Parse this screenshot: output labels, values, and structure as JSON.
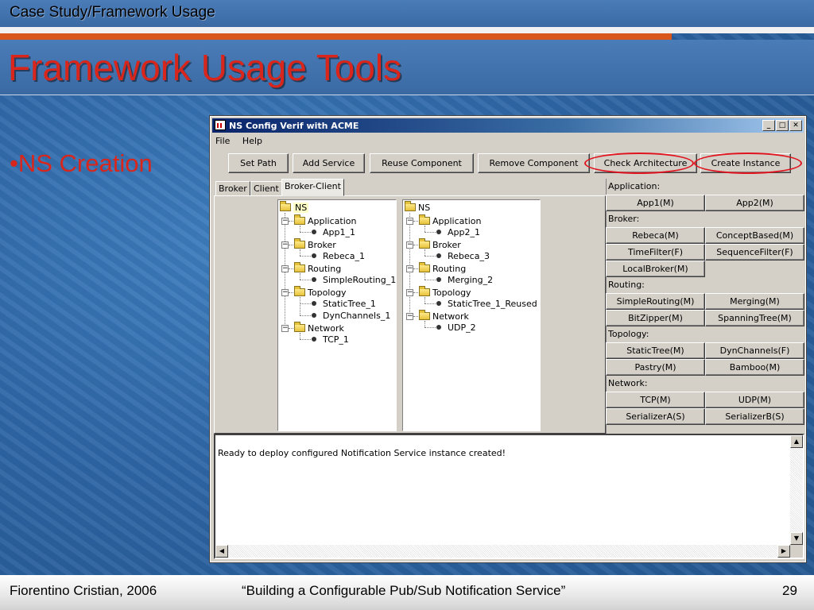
{
  "slide": {
    "section_label": "Case Study/Framework Usage",
    "title": "Framework Usage Tools",
    "bullet": "•NS Creation",
    "footer_author": "Fiorentino Cristian, 2006",
    "footer_title": "“Building a Configurable Pub/Sub Notification Service”",
    "page_number": "29"
  },
  "window": {
    "title": "NS Config Verif with ACME",
    "controls": [
      "minimize-icon",
      "maximize-icon",
      "close-icon"
    ],
    "menu": [
      "File",
      "Help"
    ],
    "buttons": [
      "Set Path",
      "Add Service",
      "Reuse Component",
      "Remove Component",
      "Check Architecture",
      "Create Instance"
    ],
    "highlighted_buttons": [
      "Check Architecture",
      "Create Instance"
    ],
    "highlight_color": "#e0141e",
    "tabs": [
      "Broker",
      "Client",
      "Broker-Client"
    ],
    "active_tab": "Broker-Client",
    "tree_left": {
      "root": "NS",
      "groups": [
        {
          "name": "Application",
          "items": [
            "App1_1"
          ]
        },
        {
          "name": "Broker",
          "items": [
            "Rebeca_1"
          ]
        },
        {
          "name": "Routing",
          "items": [
            "SimpleRouting_1"
          ]
        },
        {
          "name": "Topology",
          "items": [
            "StaticTree_1",
            "DynChannels_1"
          ]
        },
        {
          "name": "Network",
          "items": [
            "TCP_1"
          ]
        }
      ]
    },
    "tree_right": {
      "root": "NS",
      "groups": [
        {
          "name": "Application",
          "items": [
            "App2_1"
          ]
        },
        {
          "name": "Broker",
          "items": [
            "Rebeca_3"
          ]
        },
        {
          "name": "Routing",
          "items": [
            "Merging_2"
          ]
        },
        {
          "name": "Topology",
          "items": [
            "StaticTree_1_Reused"
          ]
        },
        {
          "name": "Network",
          "items": [
            "UDP_2"
          ]
        }
      ]
    },
    "component_panel": [
      {
        "header": "Application:",
        "buttons": [
          "App1(M)",
          "App2(M)"
        ]
      },
      {
        "header": "Broker:",
        "buttons": [
          "Rebeca(M)",
          "ConceptBased(M)",
          "TimeFilter(F)",
          "SequenceFilter(F)",
          "LocalBroker(M)"
        ]
      },
      {
        "header": "Routing:",
        "buttons": [
          "SimpleRouting(M)",
          "Merging(M)",
          "BitZipper(M)",
          "SpanningTree(M)"
        ]
      },
      {
        "header": "Topology:",
        "buttons": [
          "StaticTree(M)",
          "DynChannels(F)",
          "Pastry(M)",
          "Bamboo(M)"
        ]
      },
      {
        "header": "Network:",
        "buttons": [
          "TCP(M)",
          "UDP(M)",
          "SerializerA(S)",
          "SerializerB(S)"
        ]
      }
    ],
    "log_text": "Ready to deploy configured Notification Service instance created!"
  }
}
